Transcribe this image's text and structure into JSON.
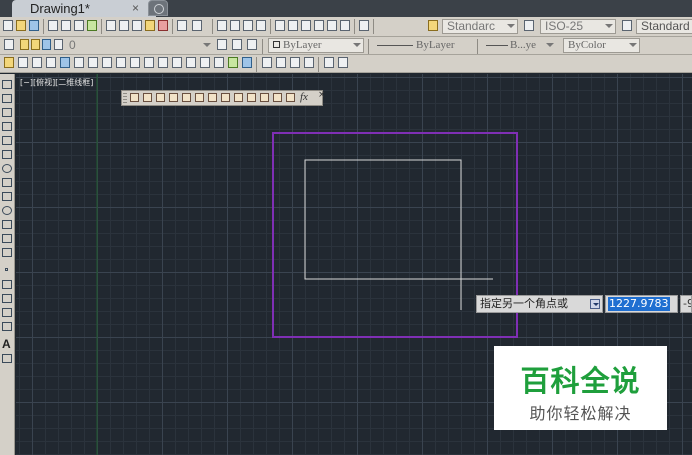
{
  "window": {
    "doc_tab_title": "Drawing1*",
    "tab_close_glyph": "×"
  },
  "toolbar_row1": {
    "text_style": "Standarc",
    "dim_style": "ISO-25",
    "table_style": "Standard"
  },
  "toolbar_row2": {
    "layer_value": "0",
    "color": "ByLayer",
    "linetype": "ByLayer",
    "lineweight": "B...ye",
    "plot_style": "ByColor"
  },
  "palette": {
    "text_tool": "A"
  },
  "viewport": {
    "label": "[−][俯视][二维线框]"
  },
  "float_toolbar": {
    "fx_label": "fx",
    "close_glyph": "×"
  },
  "dynamic_input": {
    "prompt": "指定另一个角点或",
    "value": "1227.9783",
    "second_value": "-9"
  },
  "watermark": {
    "title": "百科全说",
    "subtitle": "助你轻松解决"
  },
  "colors": {
    "canvas": "#212830",
    "selection_rect": "#7f2fb5",
    "drawn_rect": "#dcdcdc",
    "grid_axis": "#1f5a2e",
    "watermark_green": "#1f9f3c"
  }
}
